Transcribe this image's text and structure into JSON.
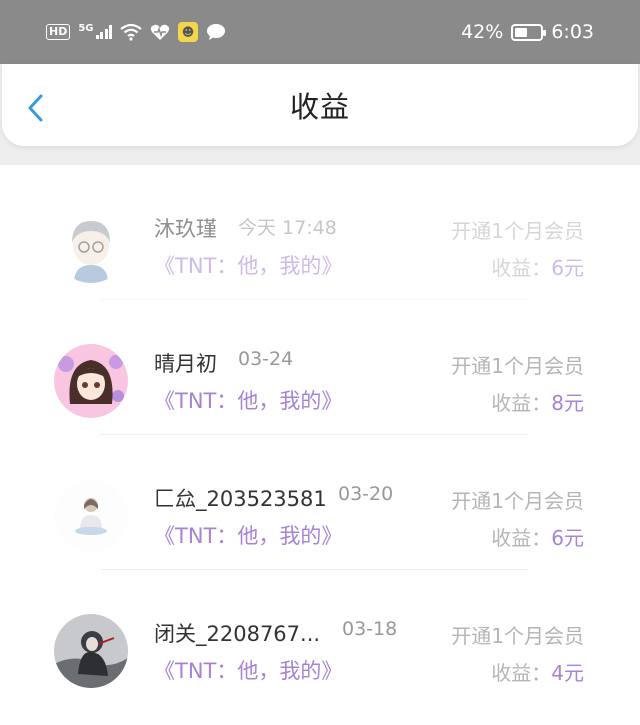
{
  "status_bar": {
    "hd": "HD",
    "signal": "5G",
    "battery": "42%",
    "time": "6:03",
    "icons": [
      "hd-icon",
      "signal-icon",
      "wifi-icon",
      "heart-icon",
      "wechat-icon",
      "chat-icon",
      "battery-icon"
    ]
  },
  "header": {
    "title": "收益",
    "back_icon": "chevron-left-icon"
  },
  "colors": {
    "accent": "#a783d6",
    "back": "#3a9ad9",
    "status_bar_bg": "#8a8a8a"
  },
  "items": [
    {
      "name": "沐玖瑾",
      "date": "今天 17:48",
      "book": "《TNT：他，我的》",
      "desc": "开通1个月会员",
      "earn_label": "收益：",
      "earn_amount": "6元"
    },
    {
      "name": "晴月初",
      "date": "03-24",
      "book": "《TNT：他，我的》",
      "desc": "开通1个月会员",
      "earn_label": "收益：",
      "earn_amount": "8元"
    },
    {
      "name": "匚厽_203523581",
      "date": "03-20",
      "book": "《TNT：他，我的》",
      "desc": "开通1个月会员",
      "earn_label": "收益：",
      "earn_amount": "6元"
    },
    {
      "name": "闭关_2208767...",
      "date": "03-18",
      "book": "《TNT：他，我的》",
      "desc": "开通1个月会员",
      "earn_label": "收益：",
      "earn_amount": "4元"
    }
  ]
}
